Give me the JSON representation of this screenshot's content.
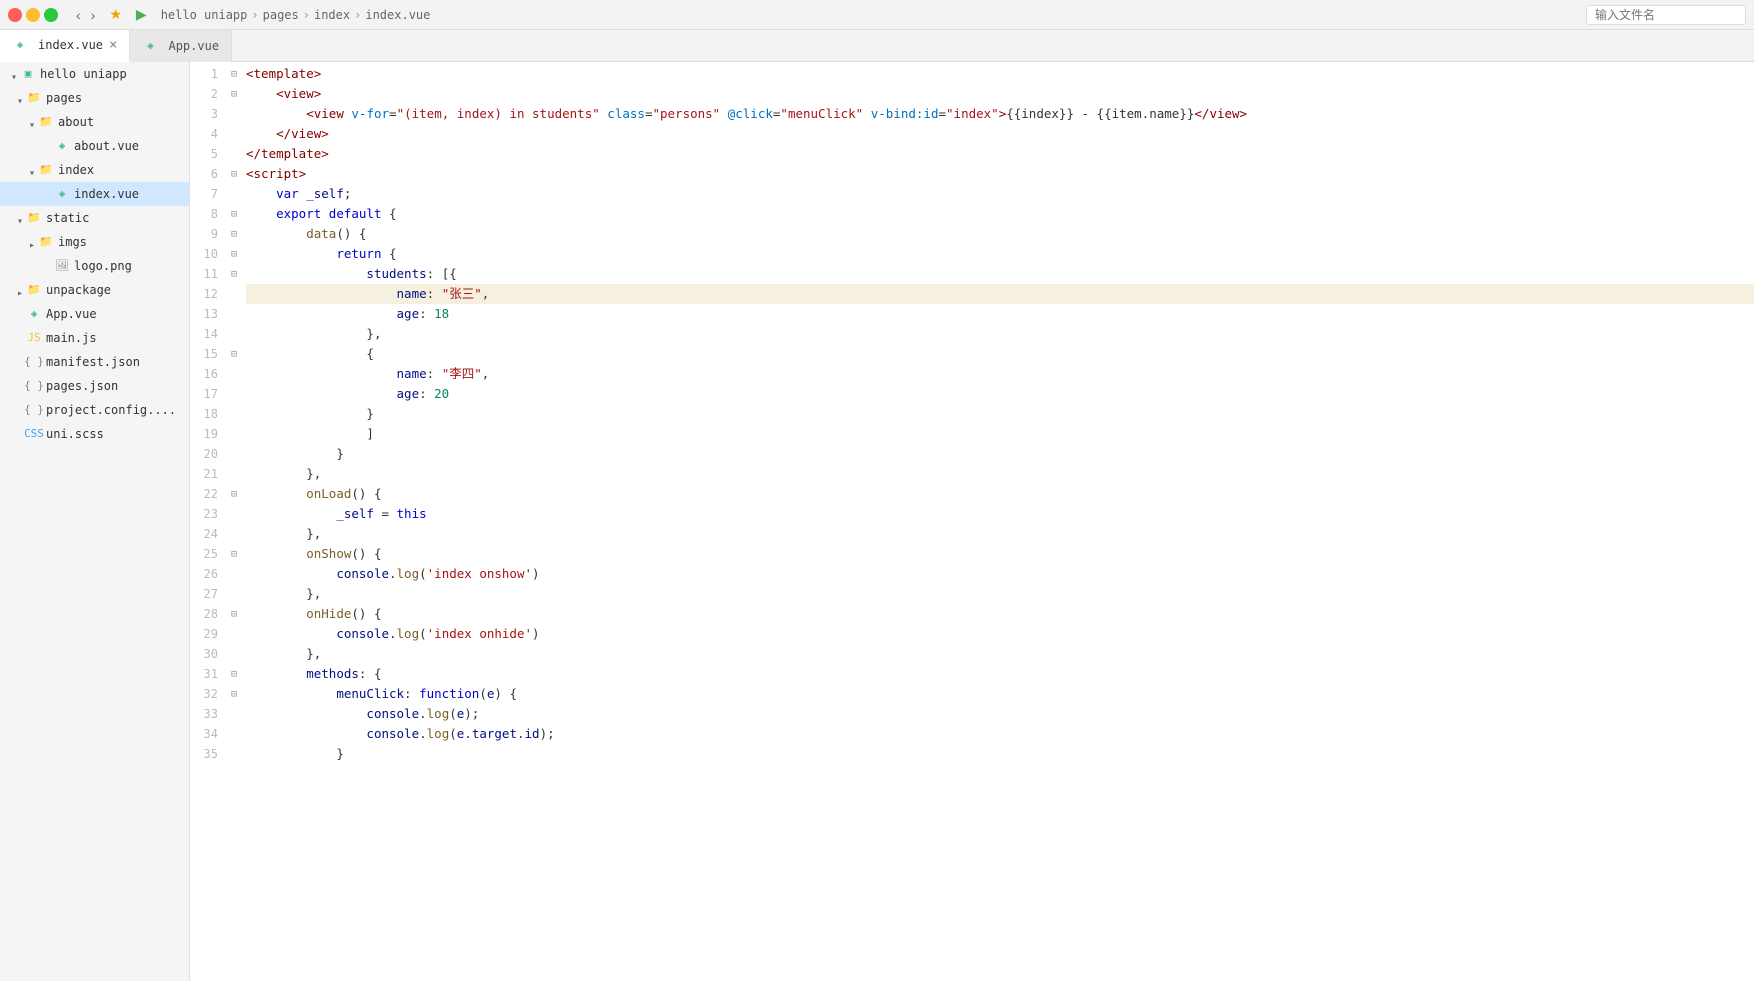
{
  "titleBar": {
    "breadcrumb": [
      "hello uniapp",
      "pages",
      "index",
      "index.vue"
    ],
    "searchPlaceholder": "输入文件名"
  },
  "tabs": [
    {
      "label": "index.vue",
      "active": true,
      "closable": true
    },
    {
      "label": "App.vue",
      "active": false,
      "closable": false
    }
  ],
  "sidebar": {
    "rootLabel": "hello uniapp",
    "items": [
      {
        "id": "pages",
        "label": "pages",
        "type": "folder",
        "open": true,
        "indent": 1
      },
      {
        "id": "about",
        "label": "about",
        "type": "folder",
        "open": true,
        "indent": 2
      },
      {
        "id": "about-vue",
        "label": "about.vue",
        "type": "vue",
        "indent": 3
      },
      {
        "id": "index",
        "label": "index",
        "type": "folder",
        "open": true,
        "indent": 2
      },
      {
        "id": "index-vue",
        "label": "index.vue",
        "type": "vue",
        "selected": true,
        "indent": 3
      },
      {
        "id": "static",
        "label": "static",
        "type": "folder",
        "open": true,
        "indent": 1
      },
      {
        "id": "imgs",
        "label": "imgs",
        "type": "folder",
        "open": false,
        "indent": 2
      },
      {
        "id": "logo-png",
        "label": "logo.png",
        "type": "png",
        "indent": 3
      },
      {
        "id": "unpackage",
        "label": "unpackage",
        "type": "folder",
        "open": false,
        "indent": 1
      },
      {
        "id": "app-vue",
        "label": "App.vue",
        "type": "vue",
        "indent": 1
      },
      {
        "id": "main-js",
        "label": "main.js",
        "type": "js",
        "indent": 1
      },
      {
        "id": "manifest-json",
        "label": "manifest.json",
        "type": "json",
        "indent": 1
      },
      {
        "id": "pages-json",
        "label": "pages.json",
        "type": "json",
        "indent": 1
      },
      {
        "id": "project-config",
        "label": "project.config....",
        "type": "json",
        "indent": 1
      },
      {
        "id": "uni-scss",
        "label": "uni.scss",
        "type": "css",
        "indent": 1
      }
    ]
  },
  "editor": {
    "filename": "index.vue",
    "lines": [
      {
        "num": 1,
        "fold": true,
        "content": "<template>",
        "highlighted": false
      },
      {
        "num": 2,
        "fold": true,
        "content": "    <view>",
        "highlighted": false
      },
      {
        "num": 3,
        "fold": false,
        "content": "        <view v-for=\"(item, index) in students\" class=\"persons\" @click=\"menuClick\" v-bind:id=\"index\">{{index}} - {{item.name}}</view>",
        "highlighted": false
      },
      {
        "num": 4,
        "fold": false,
        "content": "    </view>",
        "highlighted": false
      },
      {
        "num": 5,
        "fold": false,
        "content": "</template>",
        "highlighted": false
      },
      {
        "num": 6,
        "fold": true,
        "content": "<script>",
        "highlighted": false
      },
      {
        "num": 7,
        "fold": false,
        "content": "    var _self;",
        "highlighted": false
      },
      {
        "num": 8,
        "fold": true,
        "content": "    export default {",
        "highlighted": false
      },
      {
        "num": 9,
        "fold": true,
        "content": "        data() {",
        "highlighted": false
      },
      {
        "num": 10,
        "fold": true,
        "content": "            return {",
        "highlighted": false
      },
      {
        "num": 11,
        "fold": true,
        "content": "                students: [{",
        "highlighted": false
      },
      {
        "num": 12,
        "fold": false,
        "content": "                    name: \"张三\",",
        "highlighted": true
      },
      {
        "num": 13,
        "fold": false,
        "content": "                    age: 18",
        "highlighted": false
      },
      {
        "num": 14,
        "fold": false,
        "content": "                },",
        "highlighted": false
      },
      {
        "num": 15,
        "fold": true,
        "content": "                {",
        "highlighted": false
      },
      {
        "num": 16,
        "fold": false,
        "content": "                    name: \"李四\",",
        "highlighted": false
      },
      {
        "num": 17,
        "fold": false,
        "content": "                    age: 20",
        "highlighted": false
      },
      {
        "num": 18,
        "fold": false,
        "content": "                }",
        "highlighted": false
      },
      {
        "num": 19,
        "fold": false,
        "content": "                ]",
        "highlighted": false
      },
      {
        "num": 20,
        "fold": false,
        "content": "            }",
        "highlighted": false
      },
      {
        "num": 21,
        "fold": false,
        "content": "        },",
        "highlighted": false
      },
      {
        "num": 22,
        "fold": true,
        "content": "        onLoad() {",
        "highlighted": false
      },
      {
        "num": 23,
        "fold": false,
        "content": "            _self = this",
        "highlighted": false
      },
      {
        "num": 24,
        "fold": false,
        "content": "        },",
        "highlighted": false
      },
      {
        "num": 25,
        "fold": true,
        "content": "        onShow() {",
        "highlighted": false
      },
      {
        "num": 26,
        "fold": false,
        "content": "            console.log('index onshow')",
        "highlighted": false
      },
      {
        "num": 27,
        "fold": false,
        "content": "        },",
        "highlighted": false
      },
      {
        "num": 28,
        "fold": true,
        "content": "        onHide() {",
        "highlighted": false
      },
      {
        "num": 29,
        "fold": false,
        "content": "            console.log('index onhide')",
        "highlighted": false
      },
      {
        "num": 30,
        "fold": false,
        "content": "        },",
        "highlighted": false
      },
      {
        "num": 31,
        "fold": true,
        "content": "        methods: {",
        "highlighted": false
      },
      {
        "num": 32,
        "fold": true,
        "content": "            menuClick: function(e) {",
        "highlighted": false
      },
      {
        "num": 33,
        "fold": false,
        "content": "                console.log(e);",
        "highlighted": false
      },
      {
        "num": 34,
        "fold": false,
        "content": "                console.log(e.target.id);",
        "highlighted": false
      },
      {
        "num": 35,
        "fold": false,
        "content": "            }",
        "highlighted": false
      }
    ]
  }
}
